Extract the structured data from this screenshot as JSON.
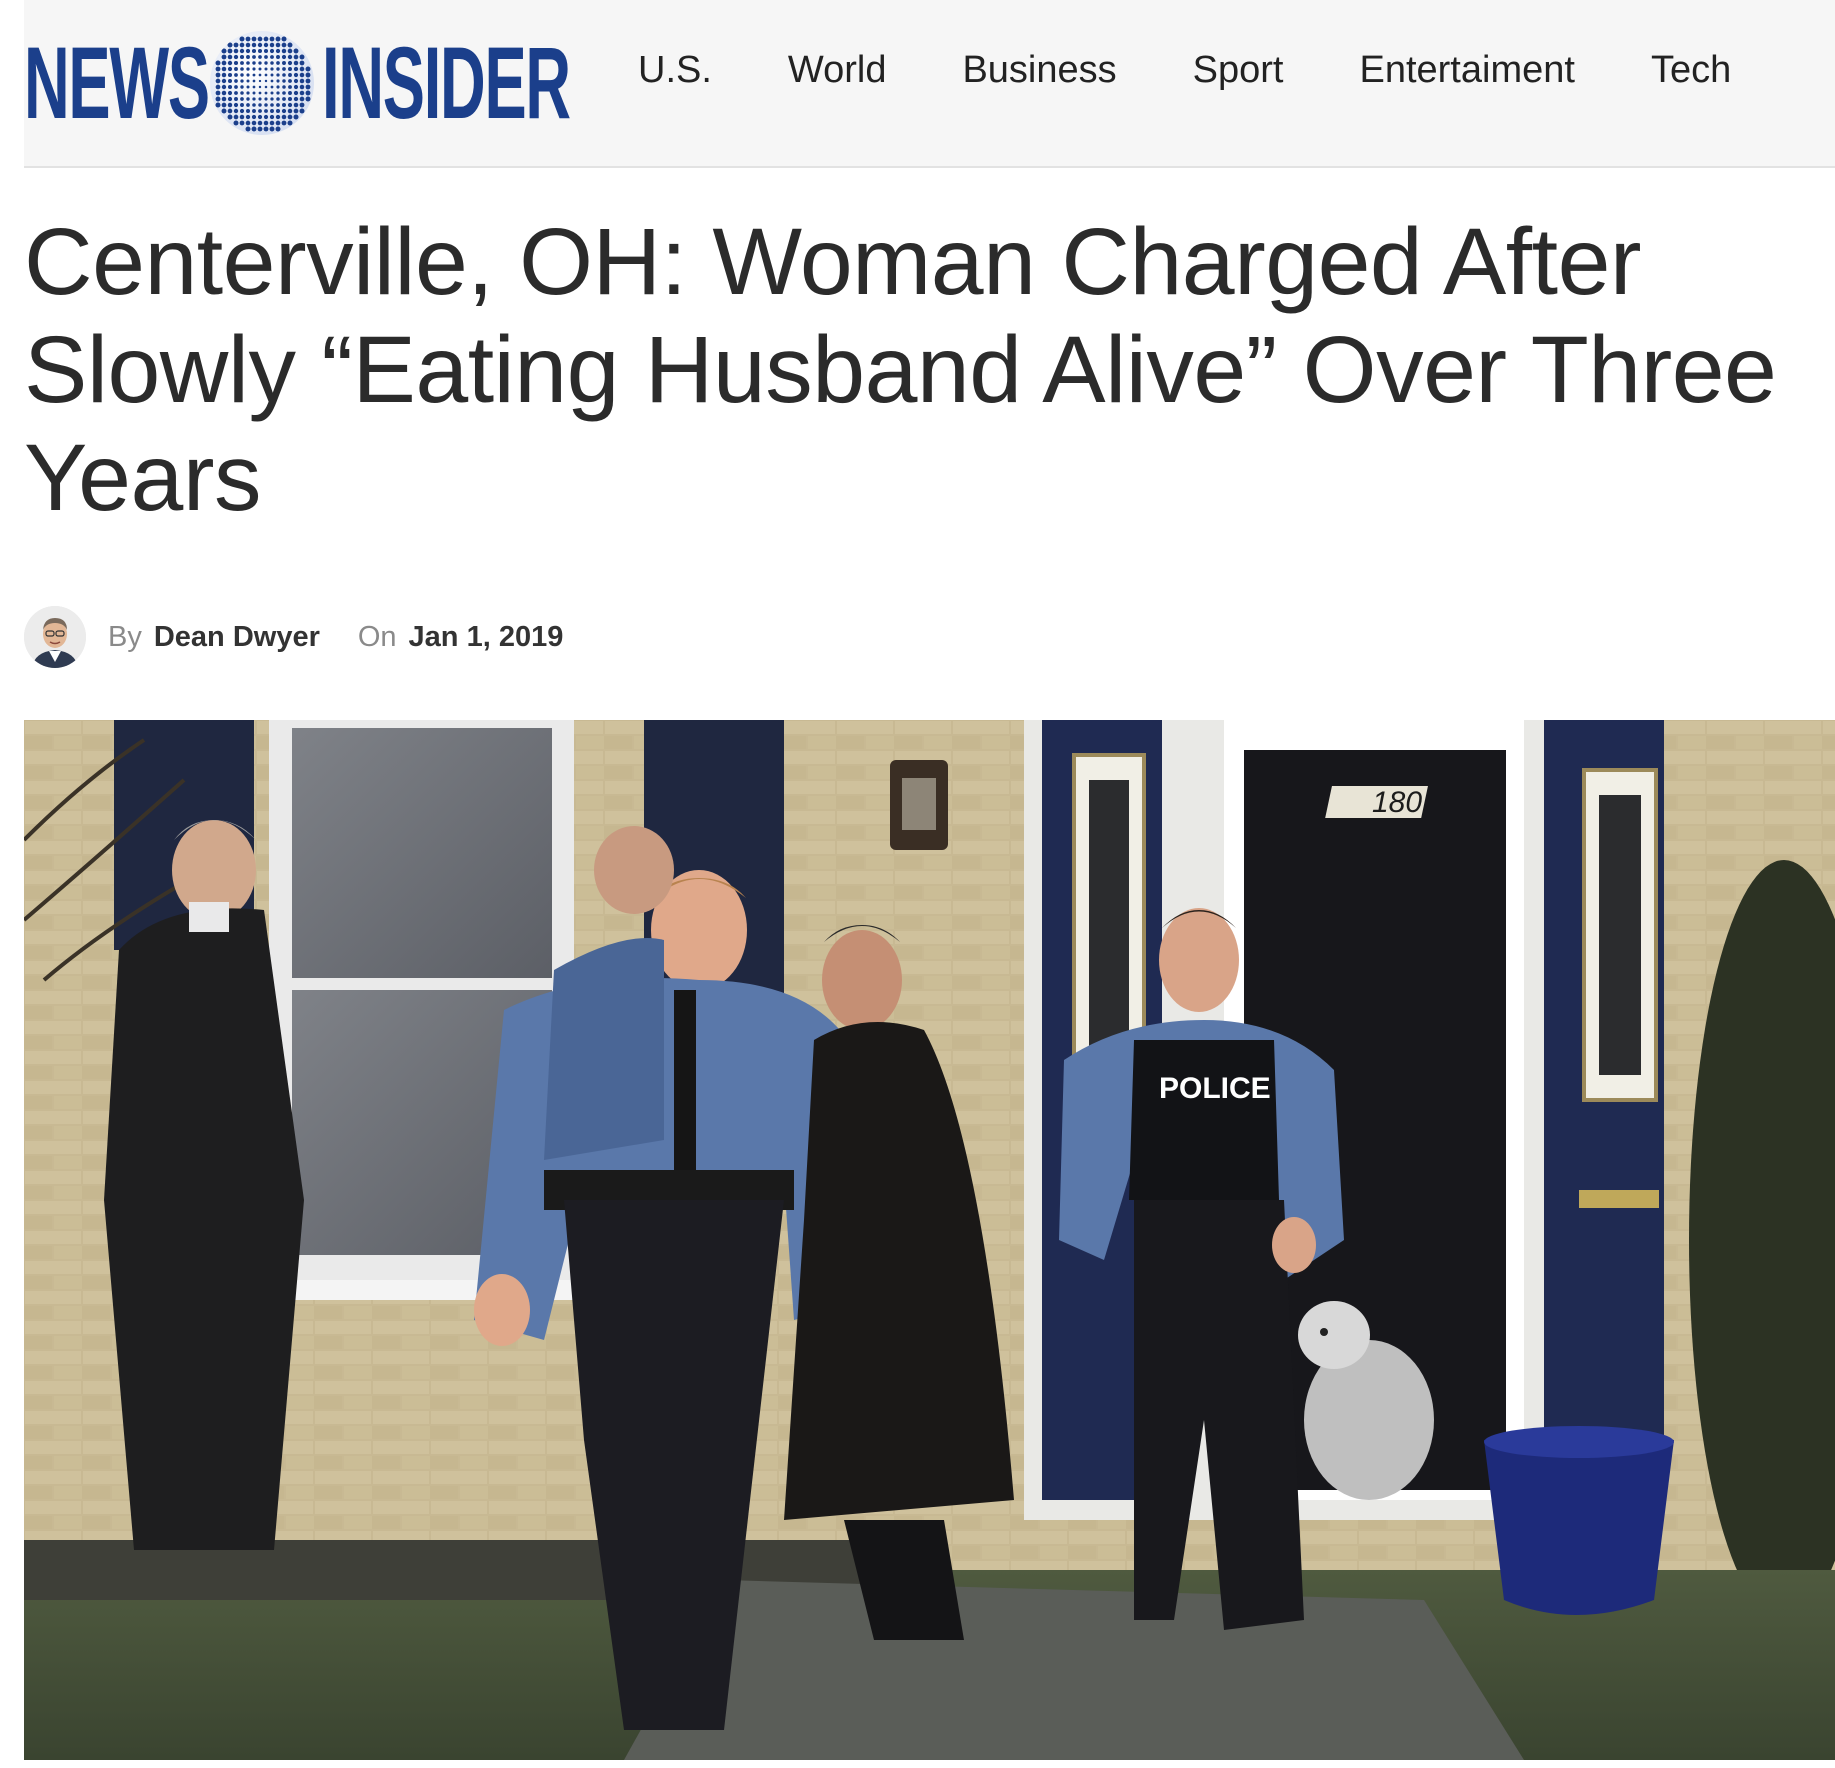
{
  "site": {
    "logo_left": "NEWS",
    "logo_right": "INSIDER",
    "logo_icon": "globe-icon",
    "brand_color": "#1b3f8b"
  },
  "nav": {
    "items": [
      "U.S.",
      "World",
      "Business",
      "Sport",
      "Entertaiment",
      "Tech"
    ]
  },
  "article": {
    "title": "Centerville, OH: Woman Charged After Slowly “Eating Husband Alive” Over Three Years",
    "by_label": "By",
    "author": "Dean Dwyer",
    "on_label": "On",
    "date": "Jan 1, 2019"
  },
  "photo": {
    "house_number": "180",
    "badge_text": "POLICE"
  }
}
